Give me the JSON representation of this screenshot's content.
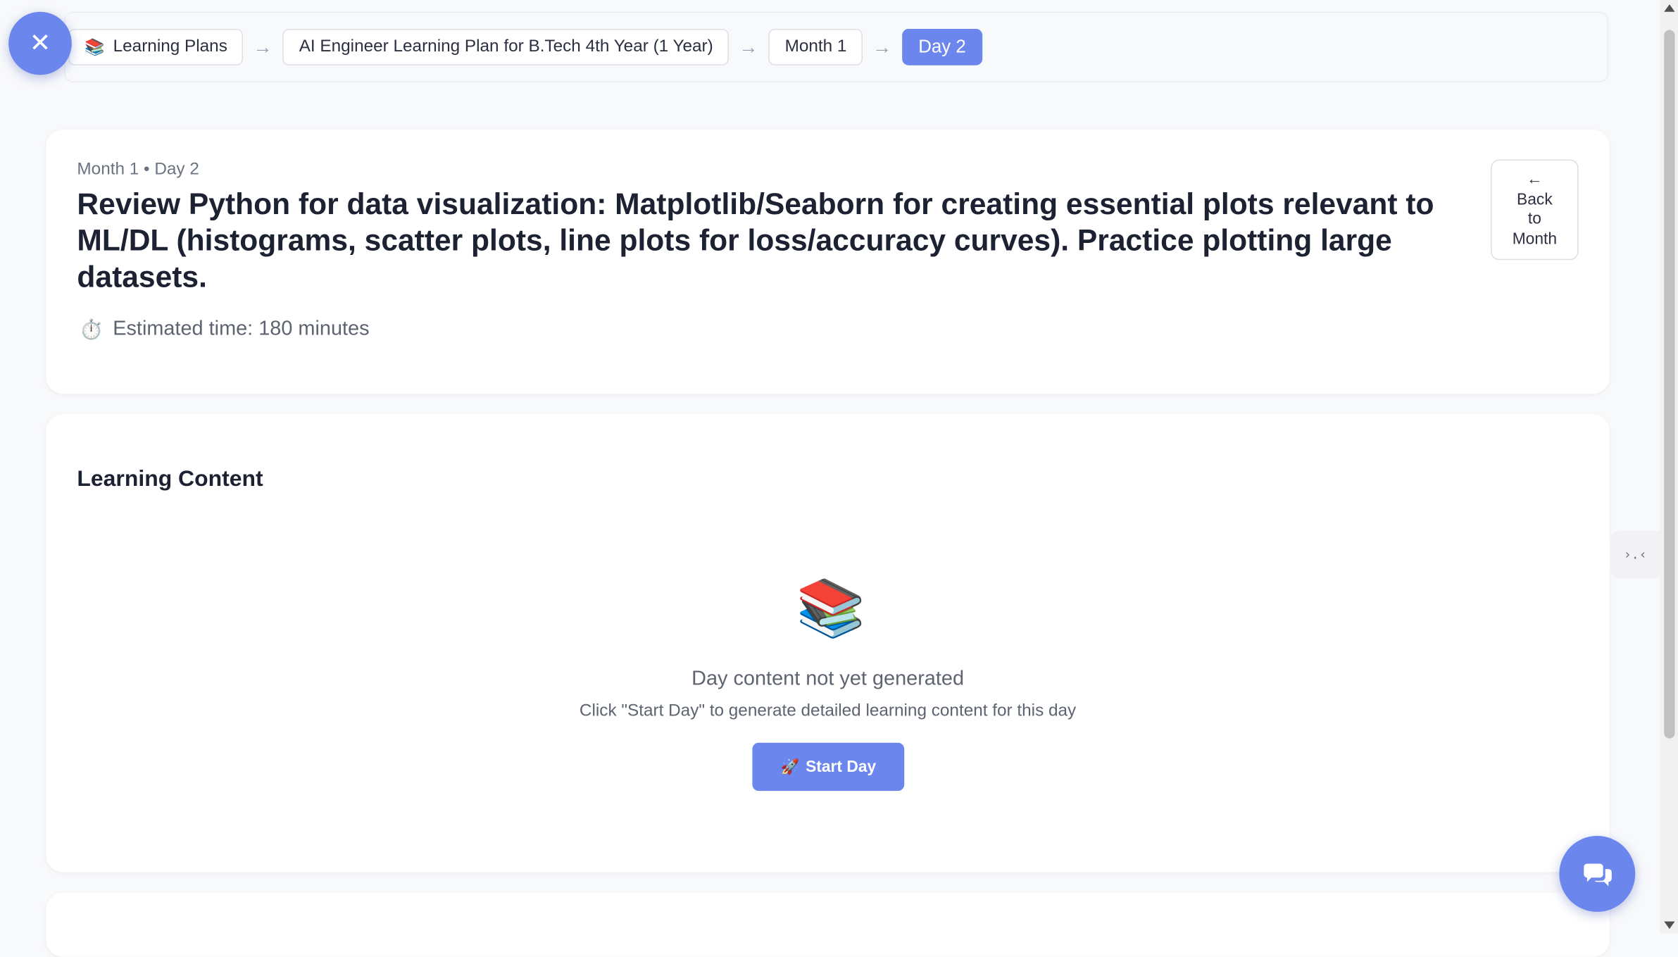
{
  "breadcrumb": {
    "items": [
      {
        "icon": "books-icon",
        "label": "Learning Plans"
      },
      {
        "label": "AI Engineer Learning Plan for B.Tech 4th Year (1 Year)"
      },
      {
        "label": "Month 1"
      },
      {
        "label": "Day 2"
      }
    ],
    "separator": "→"
  },
  "close_button": {
    "icon": "close-icon",
    "glyph": "✕"
  },
  "day_header": {
    "meta": "Month 1 • Day 2",
    "title": "Review Python for data visualization: Matplotlib/Seaborn for creating essential plots relevant to ML/DL (histograms, scatter plots, line plots for loss/accuracy curves). Practice plotting large datasets.",
    "estimated_time": "Estimated time: 180 minutes",
    "back_button": {
      "arrow": "←",
      "line1": "Back",
      "line2": "to",
      "line3": "Month"
    }
  },
  "learning_content": {
    "heading": "Learning Content",
    "empty_title": "Day content not yet generated",
    "empty_subtitle": "Click \"Start Day\" to generate detailed learning content for this day",
    "start_button": "Start Day"
  },
  "side_tab": {
    "glyph": "›.‹"
  },
  "colors": {
    "accent": "#6b86ec",
    "background": "#f8f9fb",
    "card": "#ffffff",
    "text": "#1d2233",
    "muted": "#5d6470"
  }
}
